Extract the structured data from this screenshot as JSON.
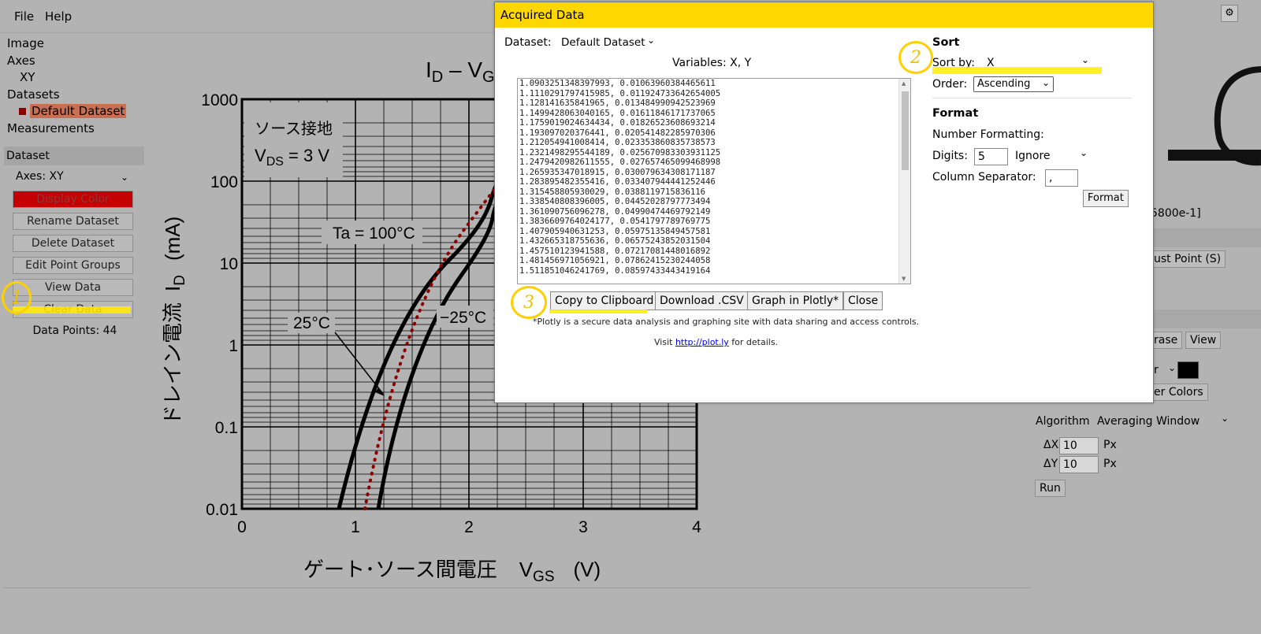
{
  "menu": {
    "file": "File",
    "help": "Help"
  },
  "sidebar": {
    "tree": [
      "Image",
      "Axes",
      "XY",
      "Datasets",
      "Default Dataset",
      "Measurements"
    ],
    "section_title": "Dataset",
    "axes_label": "Axes:  XY",
    "buttons": [
      "Display Color",
      "Rename Dataset",
      "Delete Dataset",
      "Edit Point Groups",
      "View Data",
      "Clear Data"
    ],
    "data_points": "Data Points: 44"
  },
  "graph": {
    "title_main": "I",
    "title_sub": "D",
    "title_rest": " – V",
    "title_end": "G",
    "box_line1": "ソース接地",
    "box_line2_main": "V",
    "box_line2_sub": "DS",
    "box_line2_rest": " = 3 V",
    "ann_ta": "Ta = 100°C",
    "ann_25": "25°C",
    "ann_m25": "−25°C",
    "ylabel_jp": "ドレイン電流",
    "ylabel_sym": "I",
    "ylabel_sub": "D",
    "ylabel_unit": "(mA)",
    "xlabel_jp": "ゲート･ソース間電圧",
    "xlabel_sym": "V",
    "xlabel_sub": "GS",
    "xlabel_unit": "(V)",
    "yticks": [
      "1000",
      "100",
      "10",
      "1",
      "0.1",
      "0.01"
    ],
    "xticks": [
      "0",
      "1",
      "2",
      "3",
      "4"
    ]
  },
  "right_panel": {
    "partial_value": "5800e-1]",
    "adjust_point": "ust Point (S)",
    "erase": "rase",
    "view": "View",
    "color_label": "r",
    "filter_colors": "er Colors",
    "algorithm_label": "Algorithm",
    "algorithm_value": "Averaging Window",
    "dx_label": "ΔX",
    "dx_value": "10",
    "dy_label": "ΔY",
    "dy_value": "10",
    "px": "Px",
    "run": "Run",
    "color_swatch": "#000000"
  },
  "dialog": {
    "title": "Acquired Data",
    "dataset_label": "Dataset:",
    "dataset_value": "Default Dataset",
    "variables": "Variables: X, Y",
    "data_lines": [
      "1.0903251348397993, 0.01063960384465611",
      "1.1110291797415985, 0.011924733642654005",
      "1.128141635841965, 0.013484990942523969",
      "1.1499428063040165, 0.01611846171737065",
      "1.1759019024634434, 0.01826523608693214",
      "1.193097020376441, 0.020541482285970306",
      "1.212054941008414, 0.023353860835738573",
      "1.2321498295544189, 0.025670983303931125",
      "1.2479420982611555, 0.027657465099468998",
      "1.265935347018915, 0.030079634308171187",
      "1.283895482355416, 0.033407944441252446",
      "1.315458805930029, 0.0388119715836116",
      "1.338540808396005, 0.04452028797773494",
      "1.361090756096278, 0.04990474469792149",
      "1.3836609764024177, 0.0541797789769775",
      "1.407905940631253, 0.05975135849457581",
      "1.432665318755636, 0.06575243852031504",
      "1.457510123941588, 0.07217081448016892",
      "1.481456971056921, 0.07862415230244058",
      "1.511851046241769, 0.08597433443419164"
    ],
    "sort_title": "Sort",
    "sort_by_label": "Sort by:",
    "sort_by_value": "X",
    "order_label": "Order:",
    "order_value": "Ascending",
    "format_title": "Format",
    "number_formatting": "Number Formatting:",
    "digits_label": "Digits:",
    "digits_value": "5",
    "ignore": "Ignore",
    "col_sep_label": "Column Separator:",
    "col_sep_value": ",",
    "format_btn": "Format",
    "copy_btn": "Copy to Clipboard",
    "download_btn": "Download .CSV",
    "plotly_btn": "Graph in Plotly*",
    "close_btn": "Close",
    "plotly_note": "*Plotly is a secure data analysis and graphing site with data sharing and access controls.",
    "visit": "Visit",
    "plotly_link": "http://plot.ly",
    "for_details": "for details."
  },
  "annotations": {
    "one": "1",
    "two": "2",
    "three": "3"
  },
  "colors": {
    "highlight": "#ffee00",
    "dialog_title": "#ffd700",
    "dataset_red": "#c40000"
  }
}
